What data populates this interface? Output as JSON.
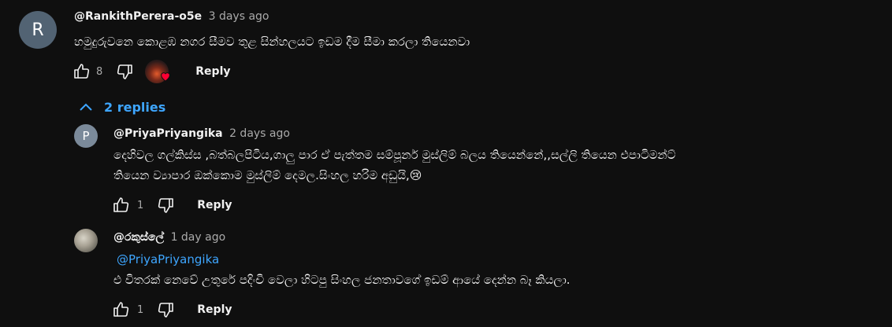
{
  "comment": {
    "avatar_letter": "R",
    "avatar_color": "#526373",
    "author": "@RankithPerera-o5e",
    "time": "3 days ago",
    "text": "හමුදුරුවනෙ කොළඹ නගර සීමව තුළ සින්හලයට ඉඩම දීම සීමා කරලා තියෙනවා",
    "like_count": "8",
    "reply_label": "Reply",
    "replies_label": "2 replies"
  },
  "replies": [
    {
      "avatar_letter": "P",
      "avatar_color": "#7b8a9a",
      "author": "@PriyaPriyangika",
      "time": "2 days ago",
      "text_line1": "දෙහිවල ගල්කිස්ස ,බත්බලපිටිය,ගාලු පාර ඒ පැත්තම සම්පූර්න මුස්ලිම් බලය තියෙන්නේ,,සල්ලි තියෙන එපාටිමන්ට්",
      "text_line2": "තියෙන ව්‍යාපාර ඔක්කොම මුස්ලිම් දෙමල.සිංහල හරිම අඩුයි,",
      "emoji": "😢",
      "like_count": "1",
      "reply_label": "Reply"
    },
    {
      "author": "@රකුස්ලේ",
      "time": "1 day ago",
      "mention": "@PriyaPriyangika",
      "text": "එ විතරක් නෙවේ උතුරේ පදිංචි වෙලා හිටපු සිංහල ජනතාවගේ ඉඩම් ආයේ දෙන්න බෑ කියලා.",
      "like_count": "1",
      "reply_label": "Reply"
    }
  ],
  "colors": {
    "background": "#0f0f0f",
    "text": "#f1f1f1",
    "secondary_text": "#aaaaaa",
    "link_blue": "#3ea6ff",
    "heart_red": "#ff0033"
  }
}
